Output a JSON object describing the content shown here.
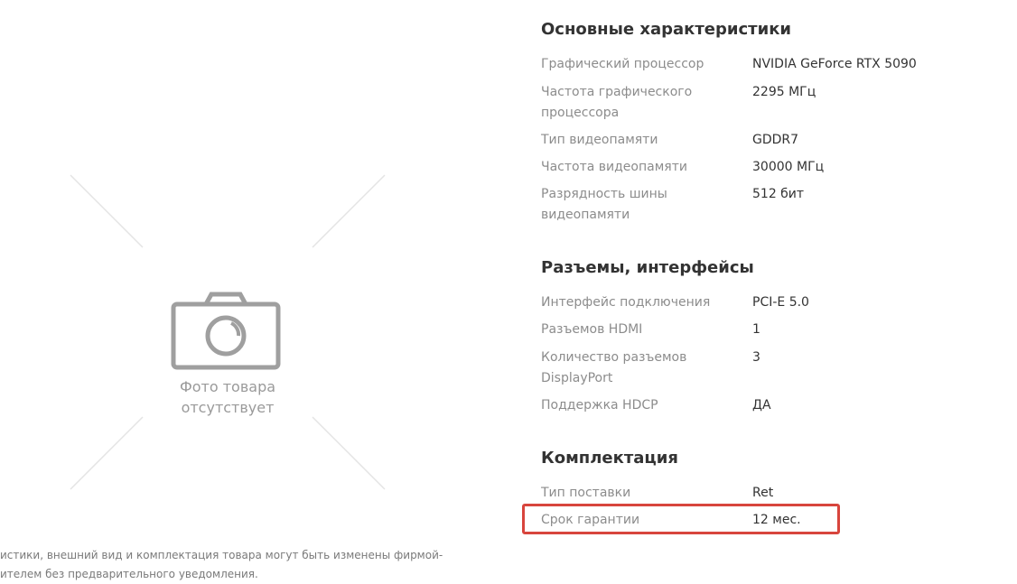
{
  "photo": {
    "caption_line1": "Фото товара",
    "caption_line2": "отсутствует",
    "icon": "camera-icon"
  },
  "disclaimer": {
    "line1": "истики, внешний вид и комплектация товара могут быть изменены фирмой-",
    "line2": "ителем без предварительного уведомления."
  },
  "sections": [
    {
      "title": "Основные характеристики",
      "rows": [
        {
          "label": "Графический процессор",
          "value": "NVIDIA GeForce RTX 5090"
        },
        {
          "label": "Частота графического процессора",
          "value": "2295 МГц"
        },
        {
          "label": "Тип видеопамяти",
          "value": "GDDR7"
        },
        {
          "label": "Частота видеопамяти",
          "value": "30000 МГц"
        },
        {
          "label": "Разрядность шины видеопамяти",
          "value": "512 бит"
        }
      ]
    },
    {
      "title": "Разъемы, интерфейсы",
      "rows": [
        {
          "label": "Интерфейс подключения",
          "value": "PCI-E 5.0"
        },
        {
          "label": "Разъемов HDMI",
          "value": "1"
        },
        {
          "label": "Количество разъемов DisplayPort",
          "value": "3"
        },
        {
          "label": "Поддержка HDCP",
          "value": "ДА"
        }
      ]
    },
    {
      "title": "Комплектация",
      "rows": [
        {
          "label": "Тип поставки",
          "value": "Ret"
        },
        {
          "label": "Срок гарантии",
          "value": "12 мес."
        }
      ]
    }
  ],
  "colors": {
    "highlight": "#d8453d",
    "label": "#8c8c8c",
    "value": "#333333"
  }
}
